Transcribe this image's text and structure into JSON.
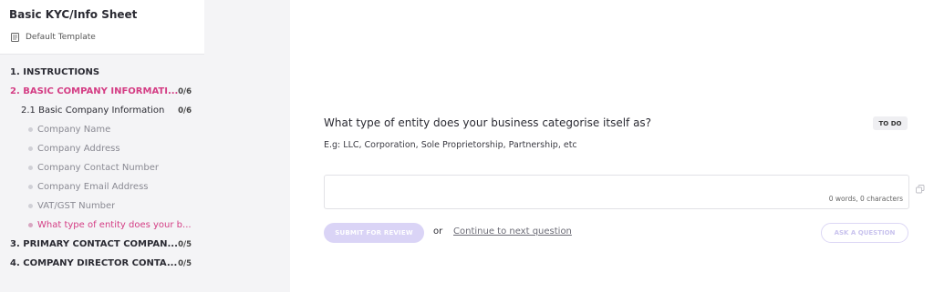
{
  "sidebar": {
    "title": "Basic KYC/Info Sheet",
    "template_label": "Default Template",
    "sections": [
      {
        "label": "1. INSTRUCTIONS",
        "count": ""
      },
      {
        "label": "2. BASIC COMPANY INFORMATI...",
        "count": "0/6"
      },
      {
        "label": "3. PRIMARY CONTACT COMPAN...",
        "count": "0/5"
      },
      {
        "label": "4. COMPANY DIRECTOR CONTA...",
        "count": "0/5"
      }
    ],
    "subsection": {
      "label": "2.1 Basic Company Information",
      "count": "0/6"
    },
    "items": [
      "Company Name",
      "Company Address",
      "Company Contact Number",
      "Company Email Address",
      "VAT/GST Number",
      "What type of entity does your b..."
    ]
  },
  "main": {
    "question": "What type of entity does your business categorise itself as?",
    "status": "TO DO",
    "hint": "E.g: LLC, Corporation, Sole Proprietorship, Partnership, etc",
    "answer_value": "",
    "counter": "0 words, 0 characters",
    "submit_label": "SUBMIT FOR REVIEW",
    "or_label": "or",
    "continue_label": "Continue to next question",
    "ask_label": "ASK A QUESTION"
  },
  "colors": {
    "accent_pink": "#d43d84",
    "button_lavender": "#dad4f6",
    "sidebar_bg": "#f4f4f6"
  },
  "icons": [
    "document-icon",
    "copy-icon"
  ]
}
